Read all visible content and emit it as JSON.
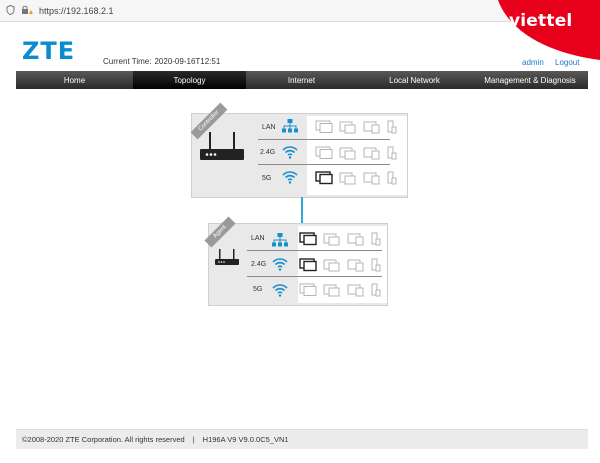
{
  "browser": {
    "url": "https://192.168.2.1"
  },
  "brand": {
    "operator": "viettel",
    "logo": "ZTE",
    "red": "#e60019",
    "zte_blue": "#0a8dd0"
  },
  "header": {
    "time_label": "Current Time:",
    "time_value": "2020-09-16T12:51",
    "admin_label": "admin",
    "logout_label": "Logout"
  },
  "nav": {
    "home": "Home",
    "topology": "Topology",
    "internet": "Internet",
    "local_network": "Local Network",
    "management": "Management & Diagnosis"
  },
  "topology": {
    "controller": {
      "ribbon": "Controller",
      "rows": [
        {
          "label": "LAN",
          "icon": "lan-icon",
          "connected": 0
        },
        {
          "label": "2.4G",
          "icon": "wifi-icon",
          "connected": 0
        },
        {
          "label": "5G",
          "icon": "wifi-icon",
          "connected": 1
        }
      ]
    },
    "agent": {
      "ribbon": "Agent",
      "rows": [
        {
          "label": "LAN",
          "icon": "lan-icon",
          "connected": 1
        },
        {
          "label": "2.4G",
          "icon": "wifi-icon",
          "connected": 1
        },
        {
          "label": "5G",
          "icon": "wifi-icon",
          "connected": 0
        }
      ]
    }
  },
  "footer": {
    "copyright": "©2008-2020 ZTE Corporation. All rights reserved",
    "separator": "|",
    "version": "H196A V9 V9.0.0C5_VN1"
  }
}
